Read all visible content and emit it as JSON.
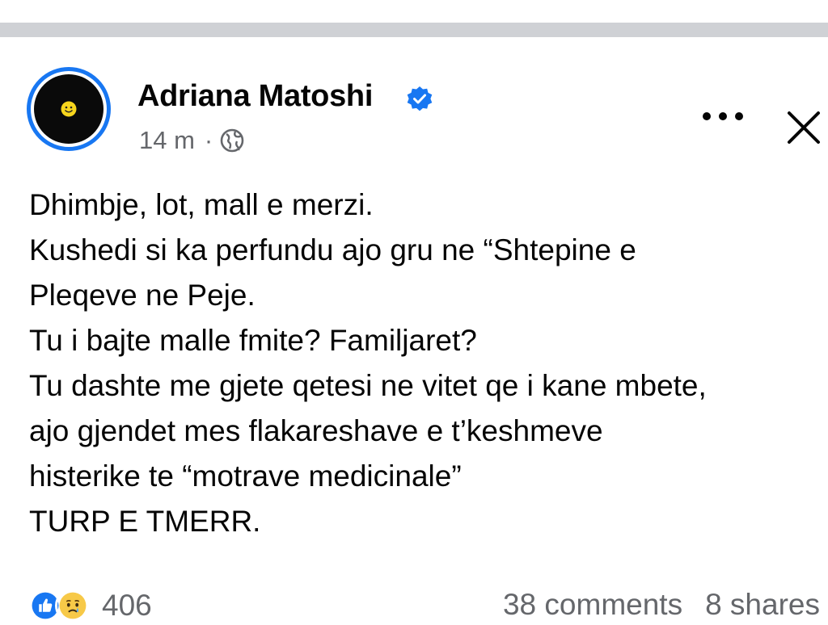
{
  "post": {
    "author": "Adriana Matoshi",
    "time": "14 m",
    "meta_separator": "·",
    "icons": {
      "avatar": "smiley-avatar",
      "verified": "verified-badge-icon",
      "privacy": "globe-icon",
      "more": "more-options-icon",
      "close": "close-icon",
      "like": "like-reaction-icon",
      "sad": "sad-reaction-icon"
    },
    "text_lines": [
      "Dhimbje, lot, mall e merzi.",
      "Kushedi si ka perfundu ajo gru ne “Shtepine e",
      "Pleqeve ne Peje.",
      "Tu i bajte malle fmite? Familjaret?",
      "Tu dashte me gjete qetesi ne vitet qe i kane mbete,",
      "ajo gjendet mes flakareshave e t’keshmeve",
      "histerike te “motrave medicinale”",
      "TURP E TMERR."
    ],
    "reaction_count": "406",
    "comments": "38 comments",
    "shares": "8 shares"
  },
  "colors": {
    "accent_blue": "#1877f2",
    "secondary_text": "#65676b",
    "primary_text": "#050505",
    "separator_bar": "#cfd1d5",
    "sad_yellow": "#f7c948"
  }
}
